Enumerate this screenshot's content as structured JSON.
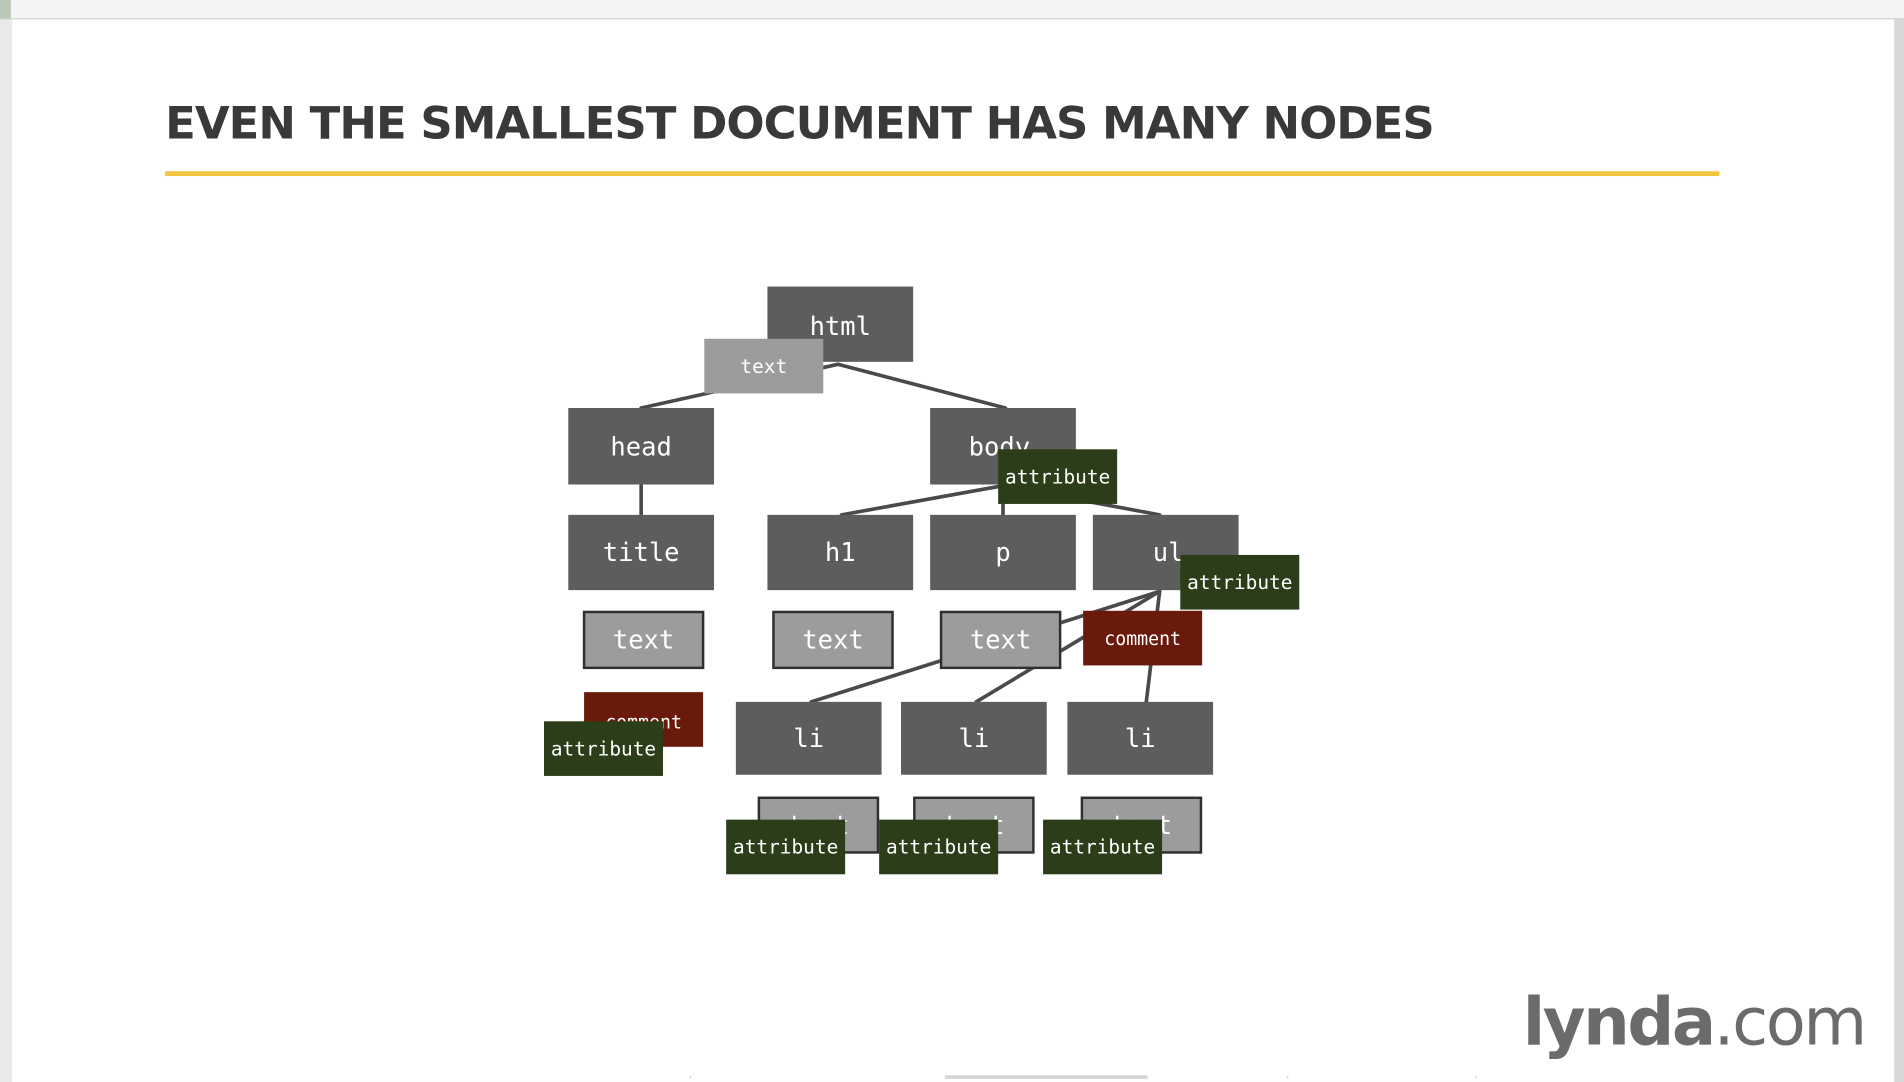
{
  "slide": {
    "title": "EVEN THE SMALLEST DOCUMENT HAS MANY NODES",
    "accent_color": "#f2c63f"
  },
  "diagram": {
    "node_colors": {
      "element": "#5d5d5e",
      "text": "#9c9c9c",
      "comment": "#6a1a0b",
      "attribute": "#2c3d19"
    },
    "nodes": {
      "html": "html",
      "html_text": "text",
      "head": "head",
      "body": "body",
      "body_attribute": "attribute",
      "title": "title",
      "h1": "h1",
      "p": "p",
      "ul": "ul",
      "ul_attribute": "attribute",
      "title_text": "text",
      "h1_text": "text",
      "p_text": "text",
      "ul_comment": "comment",
      "left_comment": "comment",
      "left_attribute": "attribute",
      "li_1": "li",
      "li_2": "li",
      "li_3": "li",
      "li_1_text": "text",
      "li_2_text": "text",
      "li_3_text": "text",
      "li_1_attribute": "attribute",
      "li_2_attribute": "attribute",
      "li_3_attribute": "attribute"
    }
  },
  "branding": {
    "logo_bold": "lynda",
    "logo_rest": ".com"
  }
}
